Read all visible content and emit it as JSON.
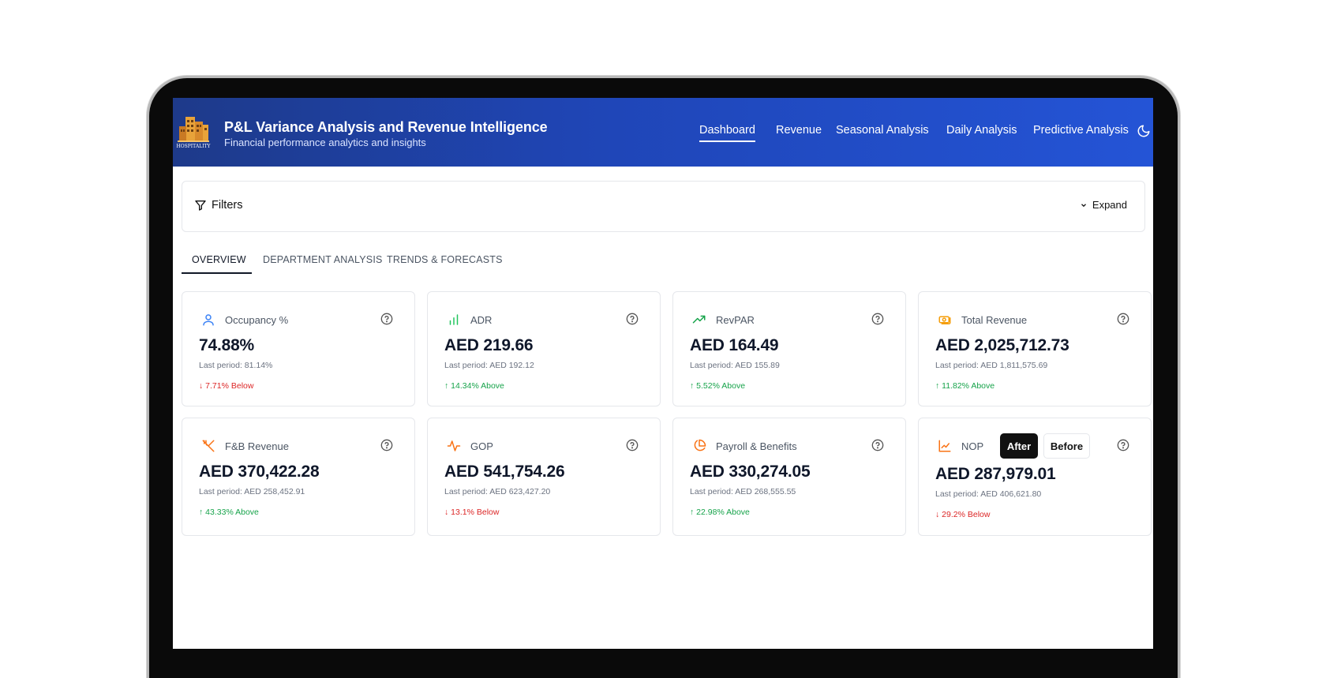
{
  "header": {
    "title": "P&L Variance Analysis and Revenue Intelligence",
    "subtitle": "Financial performance analytics and insights",
    "logo_text": "HOSPITALITY",
    "nav": [
      "Dashboard",
      "Revenue",
      "Seasonal Analysis",
      "Daily Analysis",
      "Predictive Analysis"
    ],
    "active_nav": "Dashboard",
    "theme_icon": "moon-icon"
  },
  "filters": {
    "label": "Filters",
    "expand_label": "Expand"
  },
  "tabs": [
    "OVERVIEW",
    "DEPARTMENT ANALYSIS",
    "TRENDS & FORECASTS"
  ],
  "active_tab": "OVERVIEW",
  "cards": [
    {
      "label": "Occupancy %",
      "value": "74.88%",
      "last": "Last period: 81.14%",
      "change": "7.71% Below",
      "direction": "down",
      "icon": "user-icon",
      "color": "#3b82f6"
    },
    {
      "label": "ADR",
      "value": "AED 219.66",
      "last": "Last period: AED 192.12",
      "change": "14.34% Above",
      "direction": "up",
      "icon": "bar-chart-icon",
      "color": "#22c55e"
    },
    {
      "label": "RevPAR",
      "value": "AED 164.49",
      "last": "Last period: AED 155.89",
      "change": "5.52% Above",
      "direction": "up",
      "icon": "trending-up-icon",
      "color": "#16a34a"
    },
    {
      "label": "Total Revenue",
      "value": "AED 2,025,712.73",
      "last": "Last period: AED 1,811,575.69",
      "change": "11.82% Above",
      "direction": "up",
      "icon": "cash-icon",
      "color": "#f59e0b"
    },
    {
      "label": "F&B Revenue",
      "value": "AED 370,422.28",
      "last": "Last period: AED 258,452.91",
      "change": "43.33% Above",
      "direction": "up",
      "icon": "utensils-icon",
      "color": "#f97316"
    },
    {
      "label": "GOP",
      "value": "AED 541,754.26",
      "last": "Last period: AED 623,427.20",
      "change": "13.1% Below",
      "direction": "down",
      "icon": "activity-icon",
      "color": "#f97316"
    },
    {
      "label": "Payroll & Benefits",
      "value": "AED 330,274.05",
      "last": "Last period: AED 268,555.55",
      "change": "22.98% Above",
      "direction": "up",
      "icon": "pie-chart-icon",
      "color": "#f97316"
    },
    {
      "label": "NOP",
      "value": "AED 287,979.01",
      "last": "Last period: AED 406,621.80",
      "change": "29.2% Below",
      "direction": "down",
      "icon": "line-chart-icon",
      "color": "#f97316"
    }
  ],
  "nop_toggle": {
    "after": "After",
    "before": "Before",
    "selected": "After"
  }
}
